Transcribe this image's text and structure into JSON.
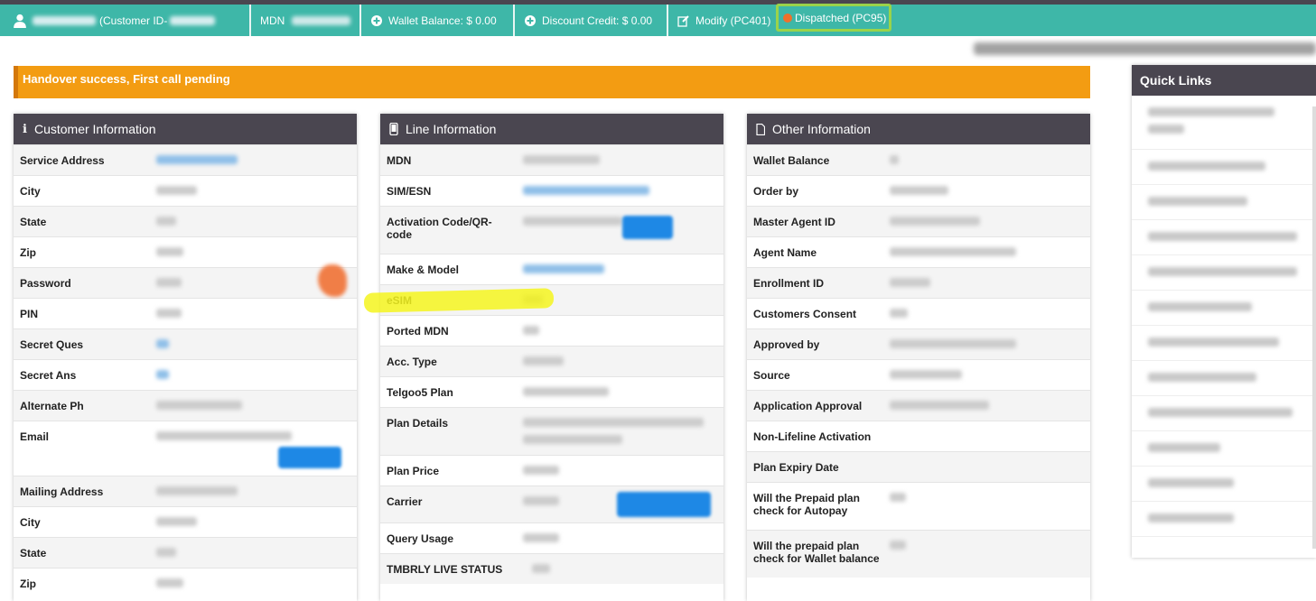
{
  "topbar": {
    "customer_id_label": "(Customer ID-",
    "mdn_label": "MDN",
    "wallet_balance": "Wallet Balance: $ 0.00",
    "discount_credit": "Discount Credit: $ 0.00",
    "modify": "Modify (PC401)",
    "dispatched": "Dispatched (PC95)"
  },
  "alert": {
    "text": "Handover success, First call pending"
  },
  "customer_info": {
    "title": "Customer Information",
    "rows": [
      "Service Address",
      "City",
      "State",
      "Zip",
      "Password",
      "PIN",
      "Secret Ques",
      "Secret Ans",
      "Alternate Ph",
      "Email",
      "Mailing Address",
      "City",
      "State",
      "Zip"
    ]
  },
  "line_info": {
    "title": "Line Information",
    "rows": [
      "MDN",
      "SIM/ESN",
      "Activation Code/QR-code",
      "Make & Model",
      "eSIM",
      "Ported MDN",
      "Acc. Type",
      "Telgoo5 Plan",
      "Plan Details",
      "Plan Price",
      "Carrier",
      "Query Usage",
      "TMBRLY LIVE STATUS"
    ]
  },
  "other_info": {
    "title": "Other Information",
    "rows": [
      "Wallet Balance",
      "Order by",
      "Master Agent ID",
      "Agent Name",
      "Enrollment ID",
      "Customers Consent",
      "Approved by",
      "Source",
      "Application Approval",
      "Non-Lifeline Activation",
      "Plan Expiry Date",
      "Will the Prepaid plan check for Autopay",
      "Will the prepaid plan check for Wallet balance"
    ]
  },
  "quick_links": {
    "title": "Quick Links"
  },
  "colors": {
    "topbar": "#3eb7a8",
    "header": "#4a4650",
    "alert": "#f39c12",
    "highlight": "#f5f51e",
    "dispatched_outline": "#9ad34a"
  },
  "icons": [
    "user-icon",
    "plus-circle-icon",
    "edit-icon",
    "info-icon",
    "mobile-icon",
    "file-icon"
  ]
}
